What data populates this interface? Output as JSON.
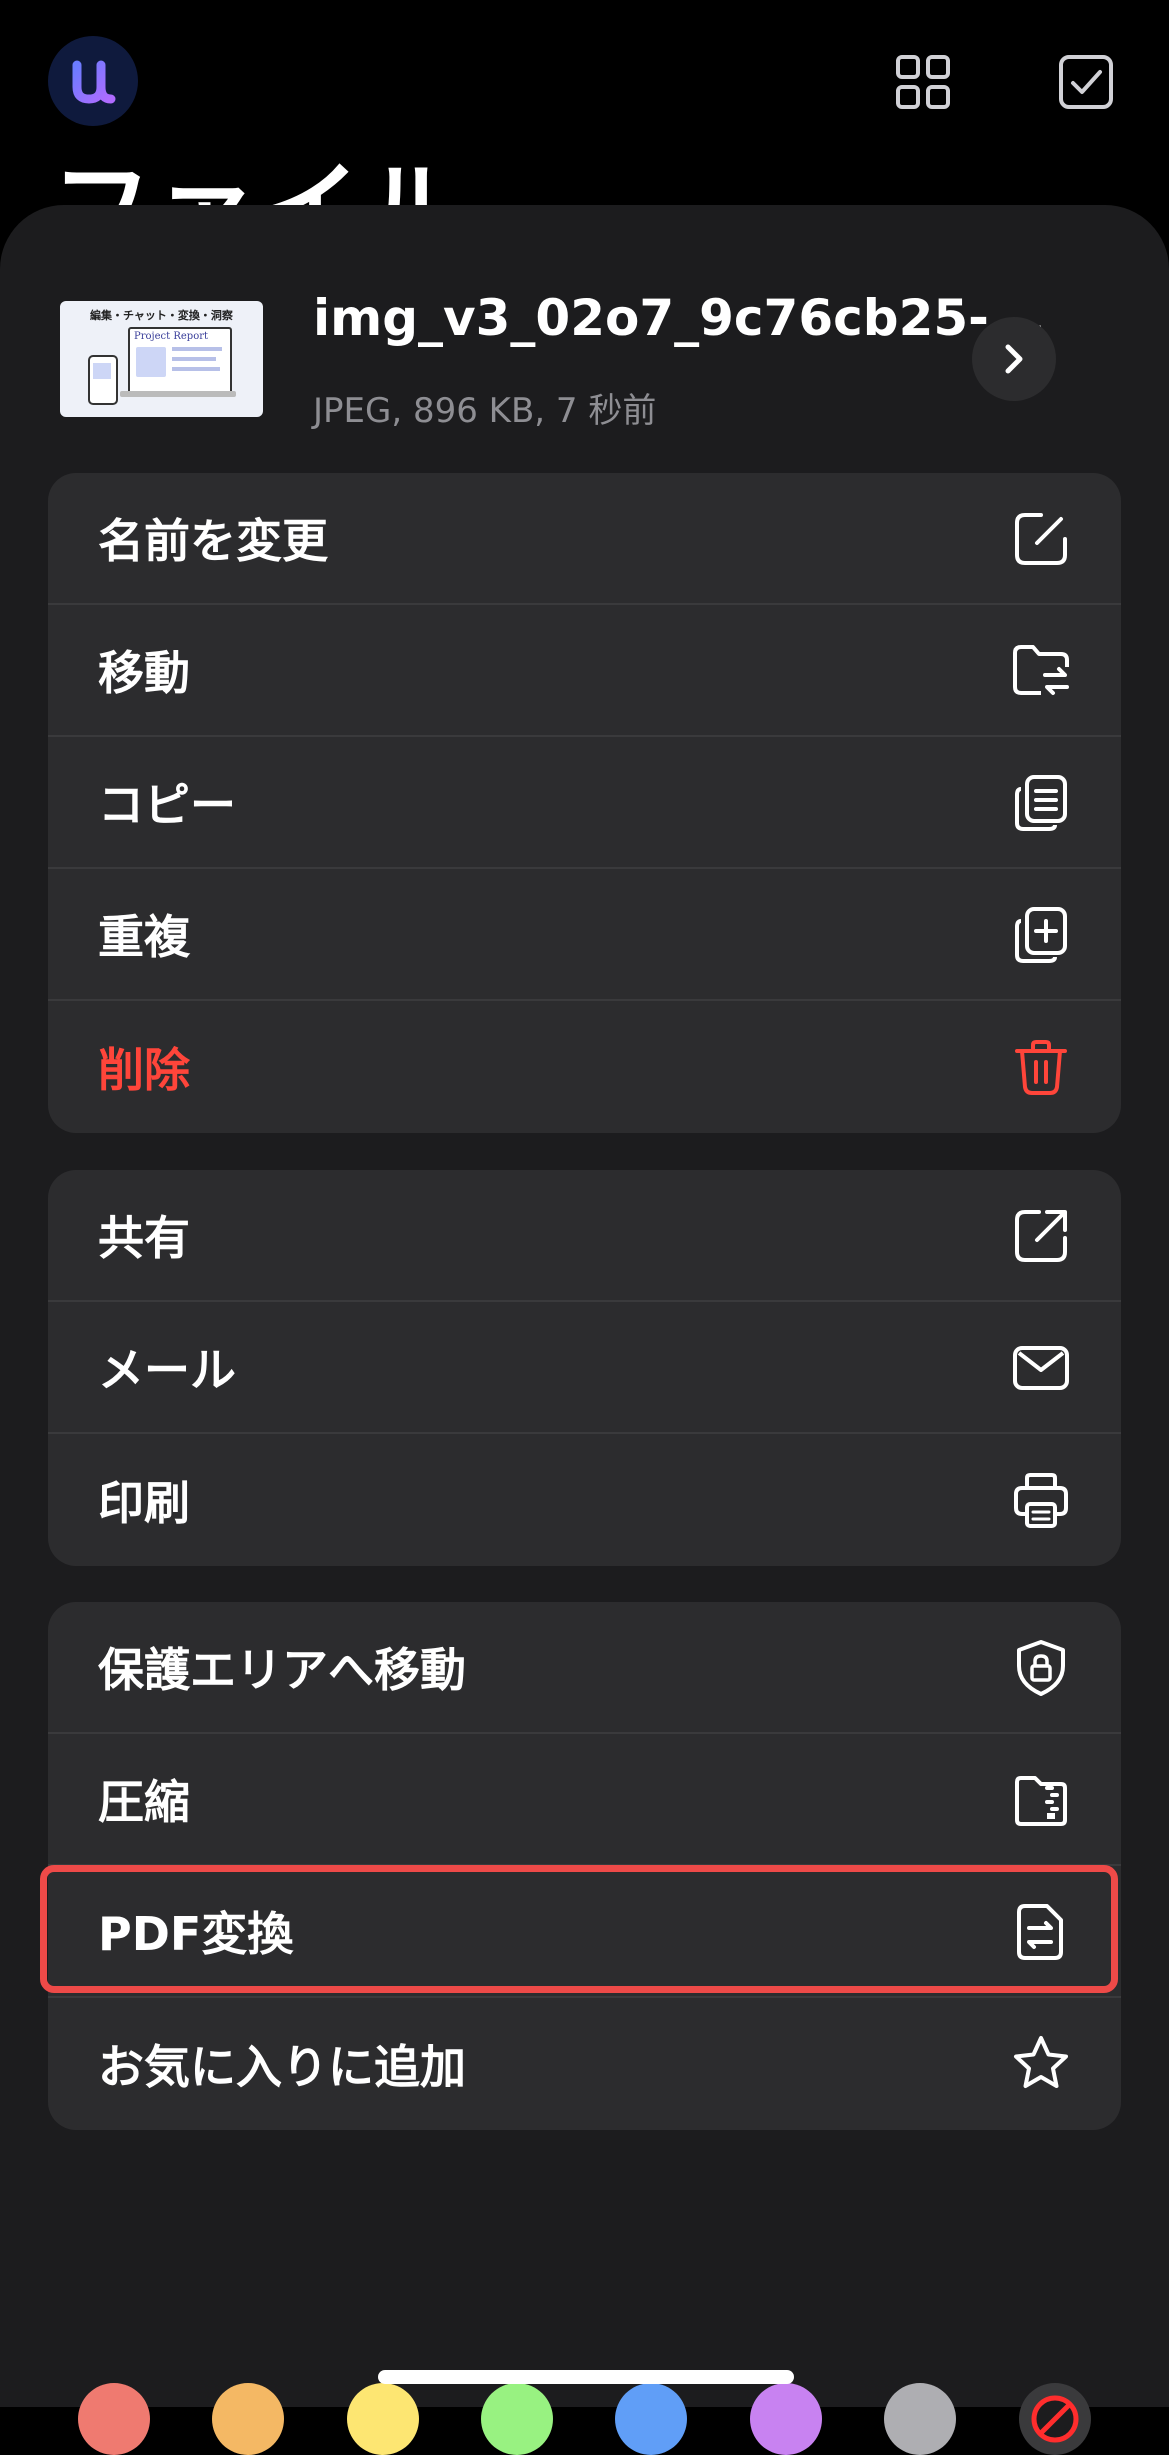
{
  "background": {
    "title": "ファイル"
  },
  "file": {
    "name": "img_v3_02o7_9c76cb25-...",
    "meta": "JPEG, 896 KB, 7 秒前",
    "thumbnail": {
      "heading": "編集・チャット・変換・洞察",
      "doc_title": "Project Report"
    }
  },
  "groups": [
    {
      "items": [
        {
          "label": "名前を変更",
          "icon": "rename-icon"
        },
        {
          "label": "移動",
          "icon": "move-folder-icon"
        },
        {
          "label": "コピー",
          "icon": "copy-icon"
        },
        {
          "label": "重複",
          "icon": "duplicate-icon"
        },
        {
          "label": "削除",
          "icon": "trash-icon",
          "color": "#ff453a"
        }
      ]
    },
    {
      "items": [
        {
          "label": "共有",
          "icon": "share-icon"
        },
        {
          "label": "メール",
          "icon": "mail-icon"
        },
        {
          "label": "印刷",
          "icon": "printer-icon"
        }
      ]
    },
    {
      "items": [
        {
          "label": "保護エリアへ移動",
          "icon": "shield-lock-icon"
        },
        {
          "label": "圧縮",
          "icon": "zip-icon"
        },
        {
          "label": "PDF変換",
          "icon": "pdf-convert-icon",
          "highlighted": true
        },
        {
          "label": "お気に入りに追加",
          "icon": "star-icon"
        }
      ]
    }
  ],
  "color_tags": [
    "#ef7a70",
    "#f4b864",
    "#fde672",
    "#98f281",
    "#609ef7",
    "#c882f1",
    "#aeaeb2"
  ],
  "colors": {
    "sheet": "#1c1c1e",
    "group": "#2c2c2e",
    "danger": "#ff453a",
    "highlight_border": "#ee4a48"
  }
}
